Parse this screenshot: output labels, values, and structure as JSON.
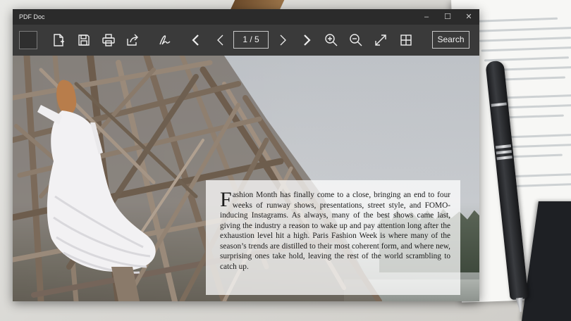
{
  "app": {
    "title": "PDF Doc"
  },
  "window_controls": {
    "minimize": "–",
    "maximize": "☐",
    "close": "✕"
  },
  "toolbar": {
    "icons": [
      "back-icon",
      "new-file-icon",
      "save-icon",
      "print-icon",
      "share-icon",
      "sign-icon",
      "first-page-icon",
      "previous-page-icon",
      "next-page-icon",
      "last-page-icon",
      "zoom-in-icon",
      "zoom-out-icon",
      "fit-page-icon",
      "grid-view-icon"
    ],
    "page_indicator": "1 / 5",
    "search_label": "Search"
  },
  "article": {
    "dropcap": "F",
    "text": "ashion Month has finally come to a close, bringing an end to four weeks of runway shows, presentations, street style, and FOMO-inducing Instagrams. As always, many of the best shows came last, giving the industry a reason to wake up and pay attention long after the exhaustion level hit a high. Paris Fashion Week is where many of the season’s trends are distilled to their most coherent form, and where new, surprising ones take hold, leaving the rest of the world scrambling to catch up."
  },
  "colors": {
    "titlebar": "#2b2b2b",
    "toolbar": "#3a3a3a",
    "toolbar_icon": "#ededed"
  }
}
